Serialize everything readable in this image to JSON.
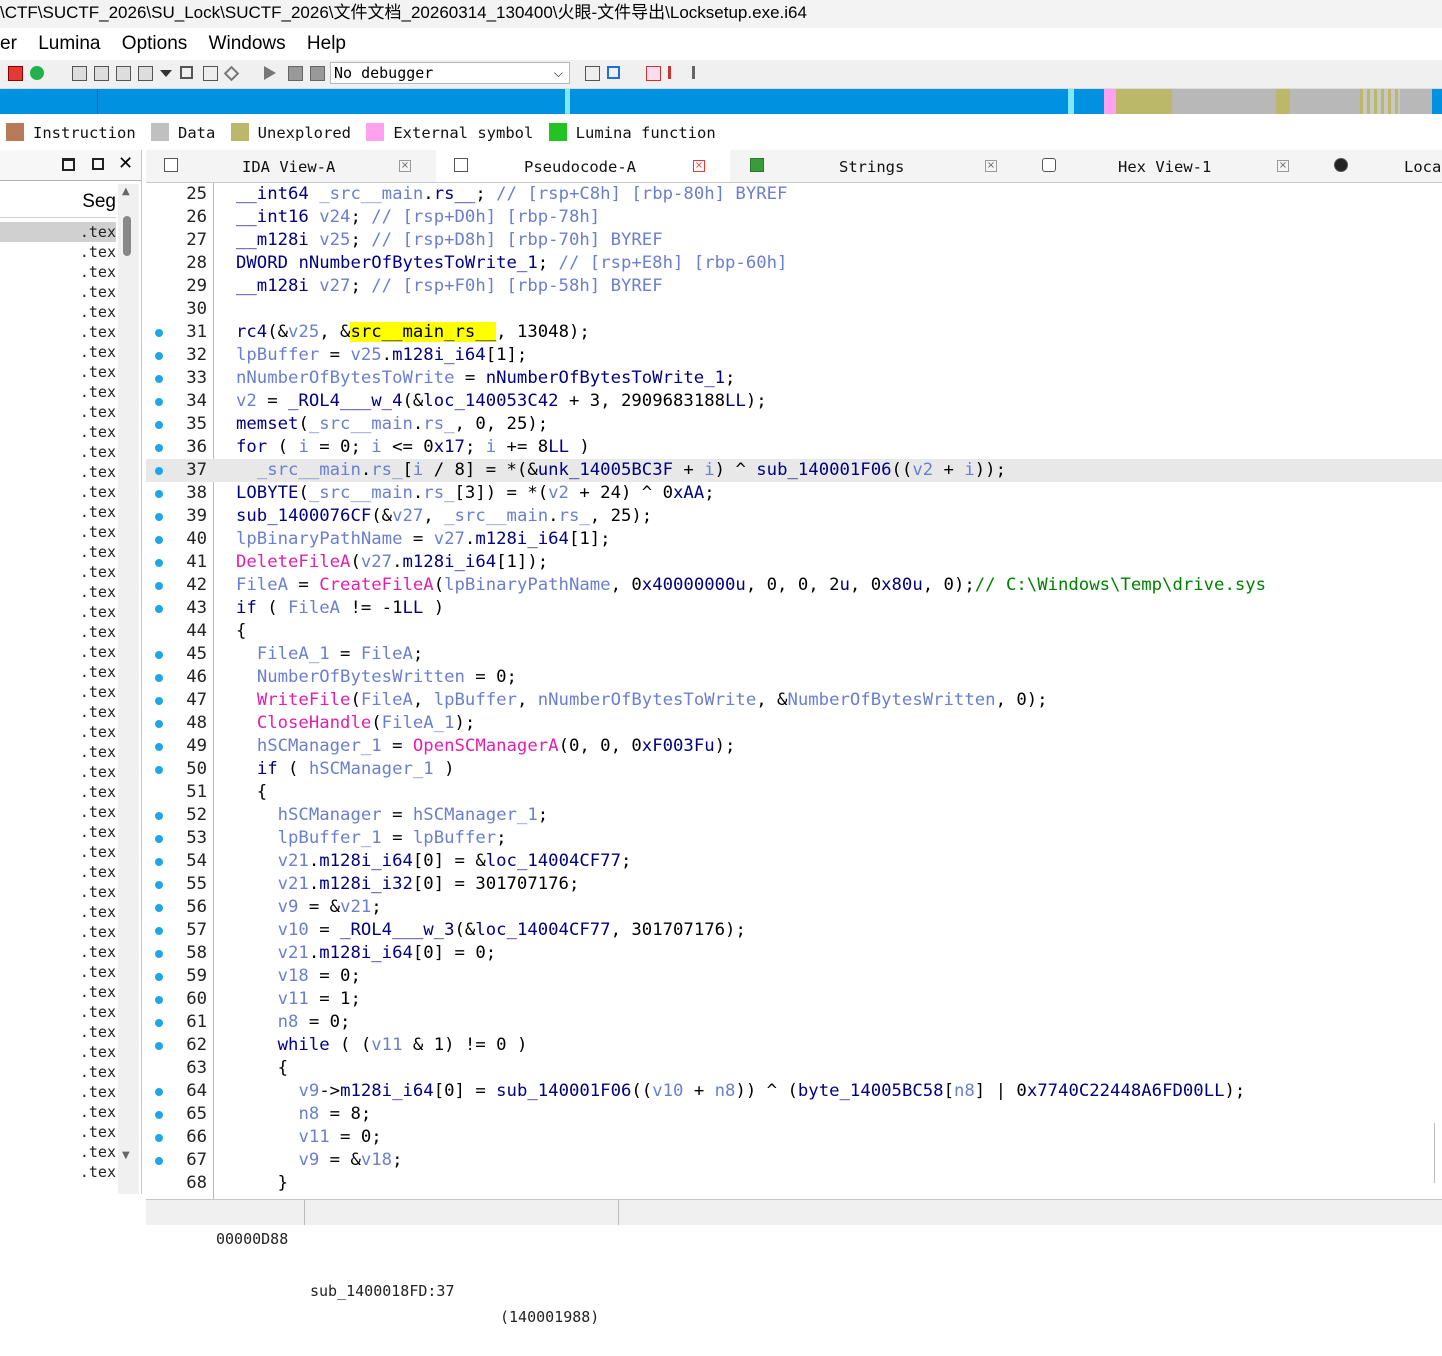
{
  "window": {
    "title": "\\CTF\\SUCTF_2026\\SU_Lock\\SUCTF_2026\\文件文档_20260314_130400\\火眼-文件导出\\Locksetup.exe.i64"
  },
  "menu": [
    "er",
    "Lumina",
    "Options",
    "Windows",
    "Help"
  ],
  "toolbar": {
    "debugger_value": "No debugger"
  },
  "colors": {
    "instruction": "#b97a57",
    "data": "#c0c0c0",
    "unexplored": "#bcb86a",
    "external_symbol": "#ffa0f0",
    "lumina_function": "#22c322",
    "nav_blue": "#0091e0",
    "nav_cyan": "#7fe7ff",
    "current_dot": "#1ea7e8"
  },
  "legend": [
    {
      "label": "Instruction",
      "color": "#b97a57"
    },
    {
      "label": "Data",
      "color": "#c0c0c0"
    },
    {
      "label": "Unexplored",
      "color": "#bcb86a"
    },
    {
      "label": "External symbol",
      "color": "#ffa0f0"
    },
    {
      "label": "Lumina function",
      "color": "#22c322"
    }
  ],
  "left_panel": {
    "column_header": "Seg",
    "row_label": ".tex",
    "row_count": 48
  },
  "tabs": [
    {
      "label": "IDA View-A",
      "icon": "disassembly-icon"
    },
    {
      "label": "Pseudocode-A",
      "icon": "pseudocode-icon"
    },
    {
      "label": "Strings",
      "icon": "strings-icon"
    },
    {
      "label": "Hex View-1",
      "icon": "hex-icon"
    },
    {
      "label": "Loca",
      "icon": "locals-icon"
    }
  ],
  "code": [
    {
      "n": "25",
      "dot": false,
      "t": "__int64 _src__main.rs__; // [rsp+C8h] [rbp-80h] BYREF"
    },
    {
      "n": "26",
      "dot": false,
      "t": "__int16 v24; // [rsp+D0h] [rbp-78h]"
    },
    {
      "n": "27",
      "dot": false,
      "t": "__m128i v25; // [rsp+D8h] [rbp-70h] BYREF"
    },
    {
      "n": "28",
      "dot": false,
      "t": "DWORD nNumberOfBytesToWrite_1; // [rsp+E8h] [rbp-60h]"
    },
    {
      "n": "29",
      "dot": false,
      "t": "__m128i v27; // [rsp+F0h] [rbp-58h] BYREF"
    },
    {
      "n": "30",
      "dot": false,
      "t": ""
    },
    {
      "n": "31",
      "dot": true,
      "t": "rc4(&v25, &src__main_rs__, 13048);"
    },
    {
      "n": "32",
      "dot": true,
      "t": "lpBuffer = v25.m128i_i64[1];"
    },
    {
      "n": "33",
      "dot": true,
      "t": "nNumberOfBytesToWrite = nNumberOfBytesToWrite_1;"
    },
    {
      "n": "34",
      "dot": true,
      "t": "v2 = _ROL4___w_4(&loc_140053C42 + 3, 2909683188LL);"
    },
    {
      "n": "35",
      "dot": true,
      "t": "memset(_src__main.rs_, 0, 25);"
    },
    {
      "n": "36",
      "dot": true,
      "t": "for ( i = 0; i <= 0x17; i += 8LL )"
    },
    {
      "n": "37",
      "dot": true,
      "t": "  _src__main.rs_[i / 8] = *(&unk_14005BC3F + i) ^ sub_140001F06((v2 + i));"
    },
    {
      "n": "38",
      "dot": true,
      "t": "LOBYTE(_src__main.rs_[3]) = *(v2 + 24) ^ 0xAA;"
    },
    {
      "n": "39",
      "dot": true,
      "t": "sub_1400076CF(&v27, _src__main.rs_, 25);"
    },
    {
      "n": "40",
      "dot": true,
      "t": "lpBinaryPathName = v27.m128i_i64[1];"
    },
    {
      "n": "41",
      "dot": true,
      "t": "DeleteFileA(v27.m128i_i64[1]);"
    },
    {
      "n": "42",
      "dot": true,
      "t": "FileA = CreateFileA(lpBinaryPathName, 0x40000000u, 0, 0, 2u, 0x80u, 0);// C:\\Windows\\Temp\\drive.sys"
    },
    {
      "n": "43",
      "dot": true,
      "t": "if ( FileA != -1LL )"
    },
    {
      "n": "44",
      "dot": false,
      "t": "{"
    },
    {
      "n": "45",
      "dot": true,
      "t": "  FileA_1 = FileA;"
    },
    {
      "n": "46",
      "dot": true,
      "t": "  NumberOfBytesWritten = 0;"
    },
    {
      "n": "47",
      "dot": true,
      "t": "  WriteFile(FileA, lpBuffer, nNumberOfBytesToWrite, &NumberOfBytesWritten, 0);"
    },
    {
      "n": "48",
      "dot": true,
      "t": "  CloseHandle(FileA_1);"
    },
    {
      "n": "49",
      "dot": true,
      "t": "  hSCManager_1 = OpenSCManagerA(0, 0, 0xF003Fu);"
    },
    {
      "n": "50",
      "dot": true,
      "t": "  if ( hSCManager_1 )"
    },
    {
      "n": "51",
      "dot": false,
      "t": "  {"
    },
    {
      "n": "52",
      "dot": true,
      "t": "    hSCManager = hSCManager_1;"
    },
    {
      "n": "53",
      "dot": true,
      "t": "    lpBuffer_1 = lpBuffer;"
    },
    {
      "n": "54",
      "dot": true,
      "t": "    v21.m128i_i64[0] = &loc_14004CF77;"
    },
    {
      "n": "55",
      "dot": true,
      "t": "    v21.m128i_i32[0] = 301707176;"
    },
    {
      "n": "56",
      "dot": true,
      "t": "    v9 = &v21;"
    },
    {
      "n": "57",
      "dot": true,
      "t": "    v10 = _ROL4___w_3(&loc_14004CF77, 301707176);"
    },
    {
      "n": "58",
      "dot": true,
      "t": "    v21.m128i_i64[0] = 0;"
    },
    {
      "n": "59",
      "dot": true,
      "t": "    v18 = 0;"
    },
    {
      "n": "60",
      "dot": true,
      "t": "    v11 = 1;"
    },
    {
      "n": "61",
      "dot": true,
      "t": "    n8 = 0;"
    },
    {
      "n": "62",
      "dot": true,
      "t": "    while ( (v11 & 1) != 0 )"
    },
    {
      "n": "63",
      "dot": false,
      "t": "    {"
    },
    {
      "n": "64",
      "dot": true,
      "t": "      v9->m128i_i64[0] = sub_140001F06((v10 + n8)) ^ (byte_14005BC58[n8] | 0x7740C22448A6FD00LL);"
    },
    {
      "n": "65",
      "dot": true,
      "t": "      n8 = 8;"
    },
    {
      "n": "66",
      "dot": true,
      "t": "      v11 = 0;"
    },
    {
      "n": "67",
      "dot": true,
      "t": "      v9 = &v18;"
    },
    {
      "n": "68",
      "dot": false,
      "t": "    }"
    }
  ],
  "current_line": "37",
  "highlight_token": "src__main_rs__",
  "status": {
    "address": "00000D88",
    "location": "sub_1400018FD:37",
    "ea": "(140001988)"
  }
}
